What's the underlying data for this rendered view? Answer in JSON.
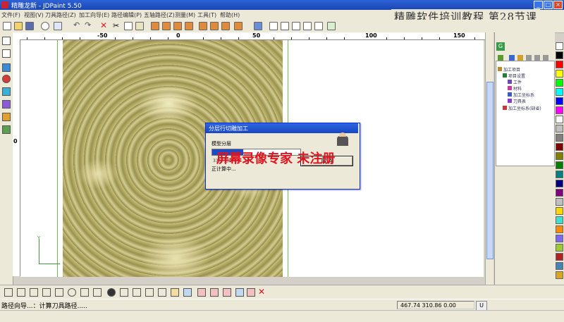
{
  "window": {
    "title": "精雕龙新 - JDPaint 5.50"
  },
  "menu": [
    "文件(F)",
    "视图(V)",
    "刀具路径(Z)",
    "加工向导(E)",
    "路径编辑(P)",
    "五轴路径(Z)",
    "测量(M)",
    "工具(T)",
    "帮助(H)"
  ],
  "overlay_title": "精雕软件培训教程   第28节课",
  "rulers": {
    "horizontal": [
      "-50",
      "0",
      "50",
      "100",
      "150"
    ],
    "vertical": [
      "0"
    ]
  },
  "axis_label": "Y",
  "dialog": {
    "title": "分层行切雕加工",
    "label": "模型分层",
    "progress": 0.35,
    "percent_text": "33% 完成",
    "status": "正计算中...",
    "cancel_label": "取消"
  },
  "watermark": "屏幕录像专家  未注册",
  "tree": {
    "tab": "G",
    "items": [
      {
        "label": "加工项目",
        "level": 0
      },
      {
        "label": "项目设置",
        "level": 1
      },
      {
        "label": "工件",
        "level": 2
      },
      {
        "label": "材料",
        "level": 2
      },
      {
        "label": "加工坐标系",
        "level": 2
      },
      {
        "label": "刀具表",
        "level": 2
      },
      {
        "label": "加工坐标系(缺省)",
        "level": 1
      }
    ]
  },
  "status": {
    "message": "路径向导...：计算刀具路径.....",
    "coords": "467.74 310.86 0.00",
    "unit": "U"
  },
  "palette": [
    "#ffffff",
    "#000000",
    "#ff0000",
    "#ffff00",
    "#00ff00",
    "#00ffff",
    "#0000ff",
    "#ff00ff",
    "#ffffff",
    "#c0c0c0",
    "#808080",
    "#800000",
    "#808000",
    "#008000",
    "#008080",
    "#000080",
    "#800080",
    "#c0c0c0",
    "#ffd700",
    "#40e0d0",
    "#ff8c00",
    "#7b68ee",
    "#9acd32",
    "#b22222",
    "#4682b4",
    "#daa520"
  ]
}
